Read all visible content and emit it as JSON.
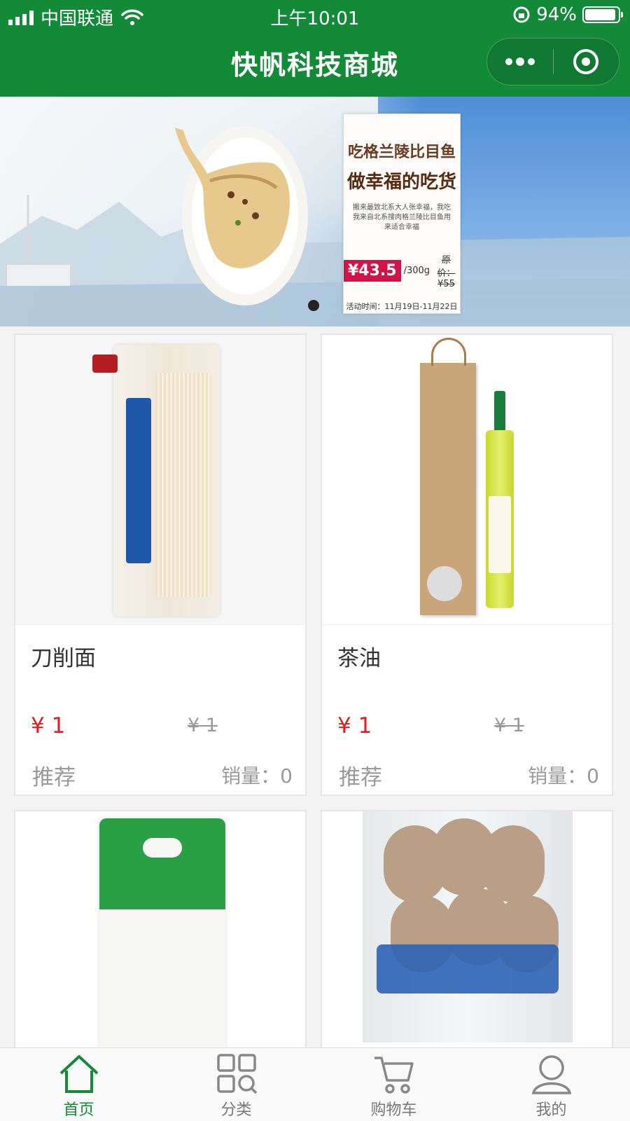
{
  "status_bar": {
    "carrier": "中国联通",
    "time": "上午10:01",
    "battery": "94%",
    "battery_level": 0.94
  },
  "nav": {
    "title": "快帆科技商城",
    "more_icon": "more-dots-icon",
    "close_icon": "record-target-icon"
  },
  "banner": {
    "headline1": "吃格兰陵比目鱼",
    "headline2": "做幸福的吃货",
    "description": "搬来最致北系大人张幸福，我吃我来自北系搜肉格兰陵比目鱼用来适合幸福",
    "price": "¥43.5",
    "unit": "/300g",
    "original": "原价：¥55",
    "activity": "活动时间：11月19日-11月22日"
  },
  "products": [
    {
      "name": "刀削面",
      "price": "¥ 1",
      "original_price": "¥ 1",
      "tag": "推荐",
      "sales": "销量：0",
      "image": "noodles-pack"
    },
    {
      "name": "茶油",
      "price": "¥ 1",
      "original_price": "¥ 1",
      "tag": "推荐",
      "sales": "销量：0",
      "image": "camellia-oil"
    },
    {
      "name": "",
      "image": "rice-bag"
    },
    {
      "name": "",
      "image": "fish-balls"
    }
  ],
  "tabbar": {
    "items": [
      {
        "label": "首页",
        "icon": "home-icon",
        "active": true
      },
      {
        "label": "分类",
        "icon": "category-icon",
        "active": false
      },
      {
        "label": "购物车",
        "icon": "cart-icon",
        "active": false
      },
      {
        "label": "我的",
        "icon": "user-icon",
        "active": false
      }
    ],
    "active_color": "#138a38"
  },
  "colors": {
    "brand_green": "#138a38",
    "price_red": "#e21d1d"
  }
}
